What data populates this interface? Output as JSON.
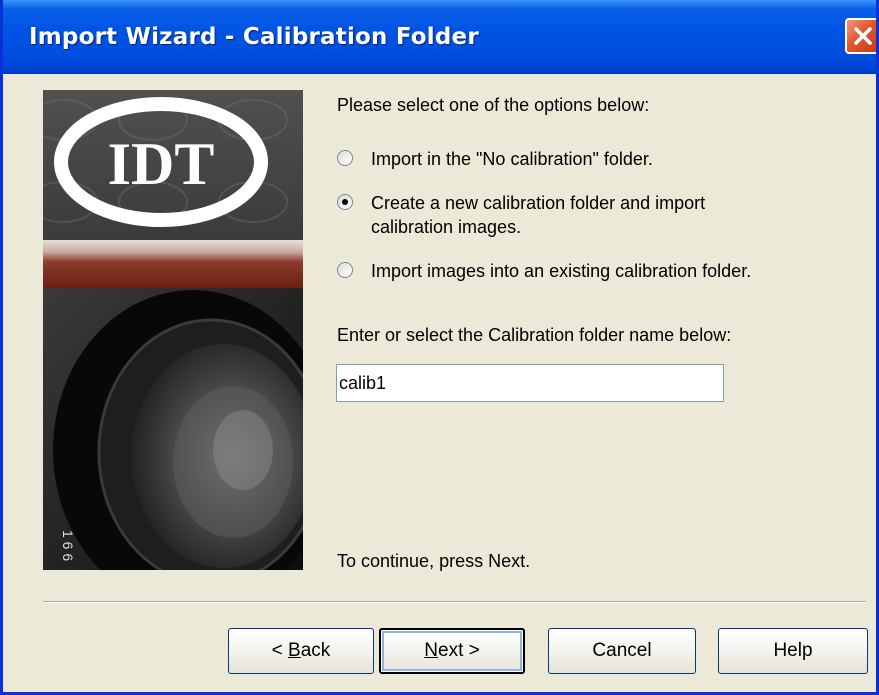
{
  "window": {
    "title": "Import Wizard - Calibration Folder"
  },
  "logo": {
    "text": "IDT",
    "lens_marking": "1 6 6"
  },
  "options": {
    "heading": "Please select one of the options below:",
    "items": [
      {
        "label": "Import in the \"No calibration\" folder.",
        "checked": false
      },
      {
        "label": "Create a new calibration folder and import calibration images.",
        "label_lines": [
          "Create a new calibration folder and import",
          "calibration images."
        ],
        "checked": true
      },
      {
        "label": "Import images into an existing calibration folder.",
        "checked": false
      }
    ]
  },
  "folder": {
    "prompt": "Enter or select the Calibration folder name below:",
    "value": "calib1"
  },
  "footer": {
    "continue_text": "To continue, press Next."
  },
  "buttons": {
    "back": {
      "prefix": "< ",
      "accel": "B",
      "rest": "ack"
    },
    "next": {
      "accel": "N",
      "rest": "ext >"
    },
    "cancel": "Cancel",
    "help": "Help"
  },
  "colors": {
    "titlebar": "#0054e3",
    "dialog_bg": "#ece9d8",
    "close": "#e0562f"
  }
}
